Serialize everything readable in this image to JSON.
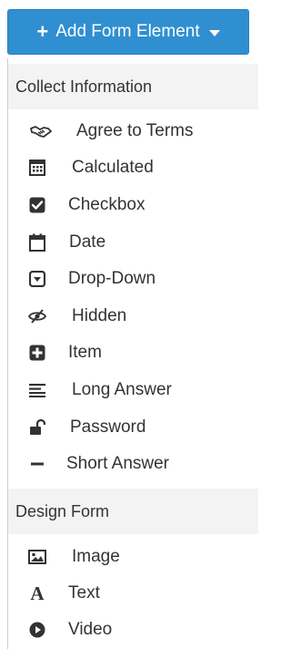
{
  "add_button": {
    "label": "Add Form Element"
  },
  "sections": [
    {
      "header": "Collect Information",
      "items": [
        {
          "label": "Agree to Terms",
          "icon": "handshake-icon"
        },
        {
          "label": "Calculated",
          "icon": "calculator-icon"
        },
        {
          "label": "Checkbox",
          "icon": "checkbox-checked-icon"
        },
        {
          "label": "Date",
          "icon": "calendar-icon"
        },
        {
          "label": "Drop-Down",
          "icon": "dropdown-caret-icon"
        },
        {
          "label": "Hidden",
          "icon": "eye-slash-icon"
        },
        {
          "label": "Item",
          "icon": "plus-square-icon"
        },
        {
          "label": "Long Answer",
          "icon": "align-lines-icon"
        },
        {
          "label": "Password",
          "icon": "unlock-icon"
        },
        {
          "label": "Short Answer",
          "icon": "minus-icon"
        }
      ]
    },
    {
      "header": "Design Form",
      "items": [
        {
          "label": "Image",
          "icon": "image-icon"
        },
        {
          "label": "Text",
          "icon": "font-icon"
        },
        {
          "label": "Video",
          "icon": "play-circle-icon"
        }
      ]
    }
  ],
  "colors": {
    "button_bg": "#2f8fd1",
    "header_bg": "#f3f3f3",
    "text": "#333333"
  }
}
